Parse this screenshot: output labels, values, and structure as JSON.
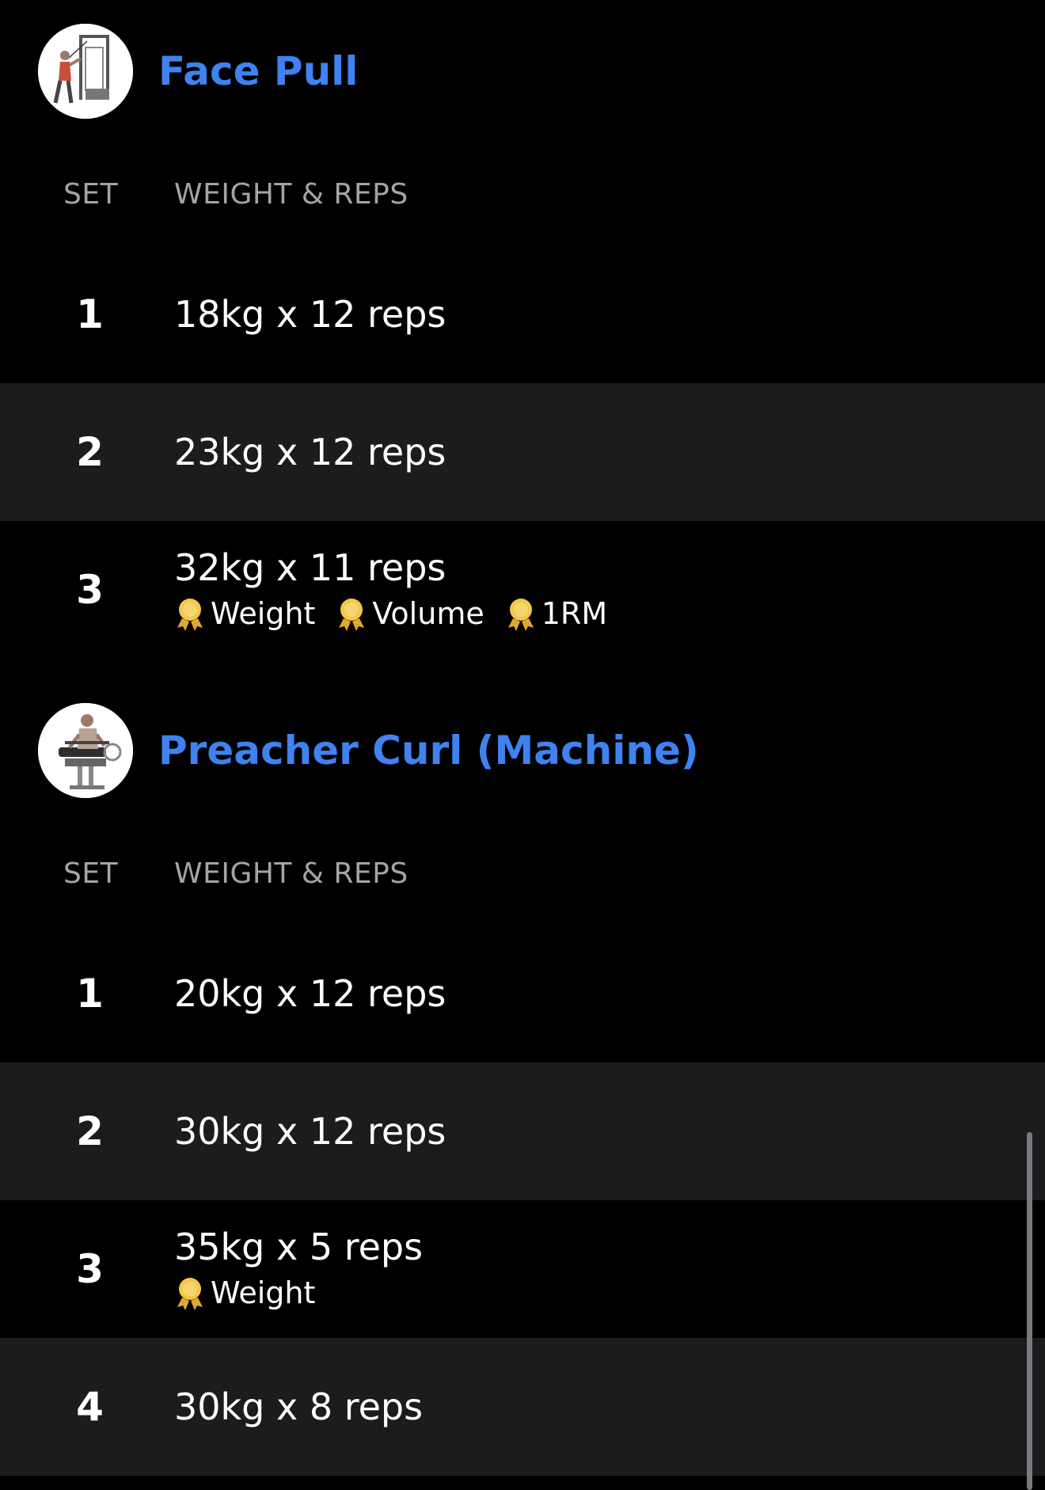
{
  "colors": {
    "background": "#000000",
    "alt_row": "#1c1c1e",
    "title_blue": "#3f82f0",
    "header_gray": "#a3a3a8",
    "medal_gold": "#f2c84b"
  },
  "exercises": [
    {
      "title": "Face Pull",
      "thumbnail_icon": "face-pull-illustration",
      "columns": {
        "set": "SET",
        "weight_reps": "WEIGHT & REPS"
      },
      "sets": [
        {
          "number": "1",
          "text": "18kg x 12 reps",
          "records": []
        },
        {
          "number": "2",
          "text": "23kg x 12 reps",
          "records": []
        },
        {
          "number": "3",
          "text": "32kg x 11 reps",
          "records": [
            "Weight",
            "Volume",
            "1RM"
          ]
        }
      ]
    },
    {
      "title": "Preacher Curl (Machine)",
      "thumbnail_icon": "preacher-curl-illustration",
      "columns": {
        "set": "SET",
        "weight_reps": "WEIGHT & REPS"
      },
      "sets": [
        {
          "number": "1",
          "text": "20kg x 12 reps",
          "records": []
        },
        {
          "number": "2",
          "text": "30kg x 12 reps",
          "records": []
        },
        {
          "number": "3",
          "text": "35kg x 5 reps",
          "records": [
            "Weight"
          ]
        },
        {
          "number": "4",
          "text": "30kg x 8 reps",
          "records": []
        }
      ]
    }
  ]
}
